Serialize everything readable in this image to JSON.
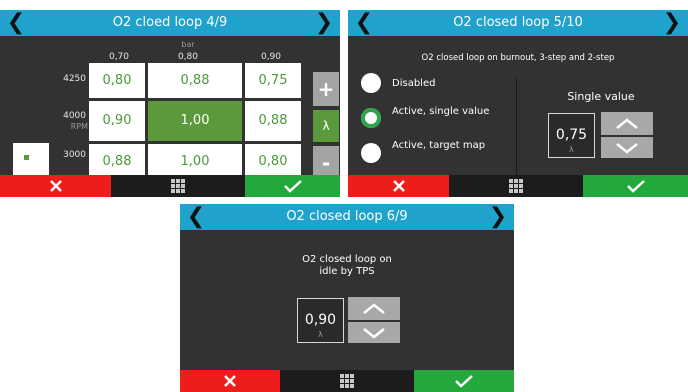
{
  "panel1": {
    "title": "O2 cloed loop 4/9",
    "col_unit": "bar",
    "columns": [
      "0,70",
      "0,80",
      "0,90"
    ],
    "row_unit": "RPM",
    "rows": [
      {
        "rpm": "4250",
        "cells": [
          "0,80",
          "0,88",
          "0,75"
        ]
      },
      {
        "rpm": "4000",
        "cells": [
          "0,90",
          "1,00",
          "0,88"
        ]
      },
      {
        "rpm": "3000",
        "cells": [
          "0,88",
          "1,00",
          "0,80"
        ]
      }
    ],
    "plus_label": "+",
    "lambda_label": "λ",
    "minus_label": "-"
  },
  "panel2": {
    "title": "O2 closed loop 5/10",
    "subtitle": "O2 closed loop on burnout, 3-step and 2-step",
    "options": [
      "Disabled",
      "Active, single value",
      "Active, target map"
    ],
    "selected_index": 1,
    "single_value_label": "Single value",
    "value": "0,75",
    "value_unit": "λ"
  },
  "panel3": {
    "title": "O2 closed loop 6/9",
    "description_line1": "O2 closed loop on",
    "description_line2": "idle by TPS",
    "value": "0,90",
    "value_unit": "λ"
  },
  "colors": {
    "header": "#1fa2cc",
    "background": "#323232",
    "cancel": "#ef1c1c",
    "confirm": "#22a83b",
    "active_cell": "#5a9a3c"
  }
}
